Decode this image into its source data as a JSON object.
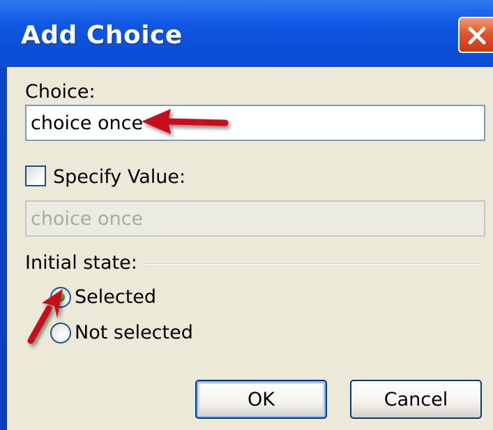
{
  "dialog": {
    "title": "Add Choice"
  },
  "choice": {
    "label": "Choice:",
    "value": "choice once"
  },
  "specify_value": {
    "label": "Specify Value:",
    "checked": false,
    "value": "choice once"
  },
  "initial_state": {
    "label": "Initial state:",
    "options": [
      {
        "label": "Selected",
        "selected": true
      },
      {
        "label": "Not selected",
        "selected": false
      }
    ]
  },
  "buttons": {
    "ok": "OK",
    "cancel": "Cancel"
  },
  "icons": {
    "close": "close-icon",
    "annotation": "red-arrow-icon"
  },
  "colors": {
    "titlebar": "#0a4fd8",
    "dialog_bg": "#ece9d8",
    "close_button": "#e2542c",
    "annotation_arrow": "#c8101a"
  }
}
